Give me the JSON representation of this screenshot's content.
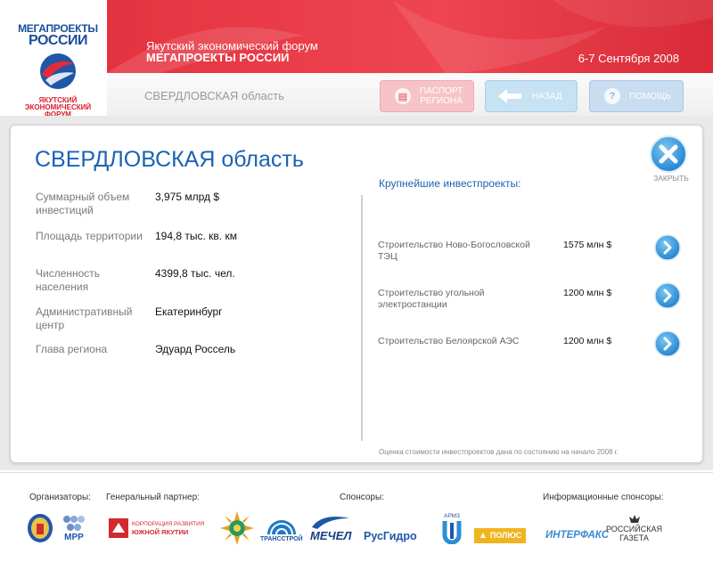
{
  "brand": {
    "top": "МЕГАПРОЕКТЫ",
    "big": "РОССИИ",
    "sub_1": "ЯКУТСКИЙ",
    "sub_2": "ЭКОНОМИЧЕСКИЙ",
    "sub_3": "ФОРУМ"
  },
  "banner": {
    "subtitle": "Якутский экономический форум",
    "title": "МЕГАПРОЕКТЫ РОССИИ",
    "date": "6-7 Сентября 2008"
  },
  "subhead": {
    "breadcrumb": "СВЕРДЛОВСКАЯ область",
    "passport_label_1": "ПАСПОРТ",
    "passport_label_2": "РЕГИОНА",
    "back_label": "НАЗАД",
    "help_label": "ПОМОЩЬ"
  },
  "region": {
    "title": "СВЕРДЛОВСКАЯ область",
    "stats": [
      {
        "label": "Суммарный объем инвестиций",
        "value": "3,975 млрд $"
      },
      {
        "label": "Площадь территории",
        "value": "194,8 тыс. кв. км"
      },
      {
        "label": "Численность населения",
        "value": "4399,8 тыс. чел."
      },
      {
        "label": "Административный центр",
        "value": "Екатеринбург"
      },
      {
        "label": "Глава региона",
        "value": "Эдуард Россель"
      }
    ]
  },
  "projects": {
    "heading": "Крупнейшие инвестпроекты:",
    "items": [
      {
        "name": "Строительство Ново-Богословской ТЭЦ",
        "cost": "1575 млн $"
      },
      {
        "name": "Строительство угольной электростанции",
        "cost": "1200 млн $"
      },
      {
        "name": "Строительство Белоярской АЭС",
        "cost": "1200 млн $"
      }
    ],
    "note": "Оценка стоимости инвестпроектов дана по состоянию на начало 2008 г."
  },
  "close_label": "ЗАКРЫТЬ",
  "footer": {
    "organizers": "Организаторы:",
    "general_partner": "Генеральный партнер:",
    "sponsors": "Спонсоры:",
    "info_sponsors": "Информационные спонсоры:",
    "logos": {
      "mrr": "МРР",
      "corp_1": "КОРПОРАЦИЯ РАЗВИТИЯ",
      "corp_2": "ЮЖНОЙ ЯКУТИИ",
      "transstroy": "ТРАНССТРОЙ",
      "mechel": "МЕЧЕЛ",
      "rushydro": "РусГидро",
      "armz": "АРМЗ",
      "polyus": "ПОЛЮС",
      "interfax": "ИНТЕРФАКС",
      "rg_1": "РОССИЙСКАЯ",
      "rg_2": "ГАЗЕТА"
    }
  },
  "colors": {
    "accent_red": "#e43340",
    "title_blue": "#1b63b3",
    "arrow_blue": "#2a8fd6"
  }
}
